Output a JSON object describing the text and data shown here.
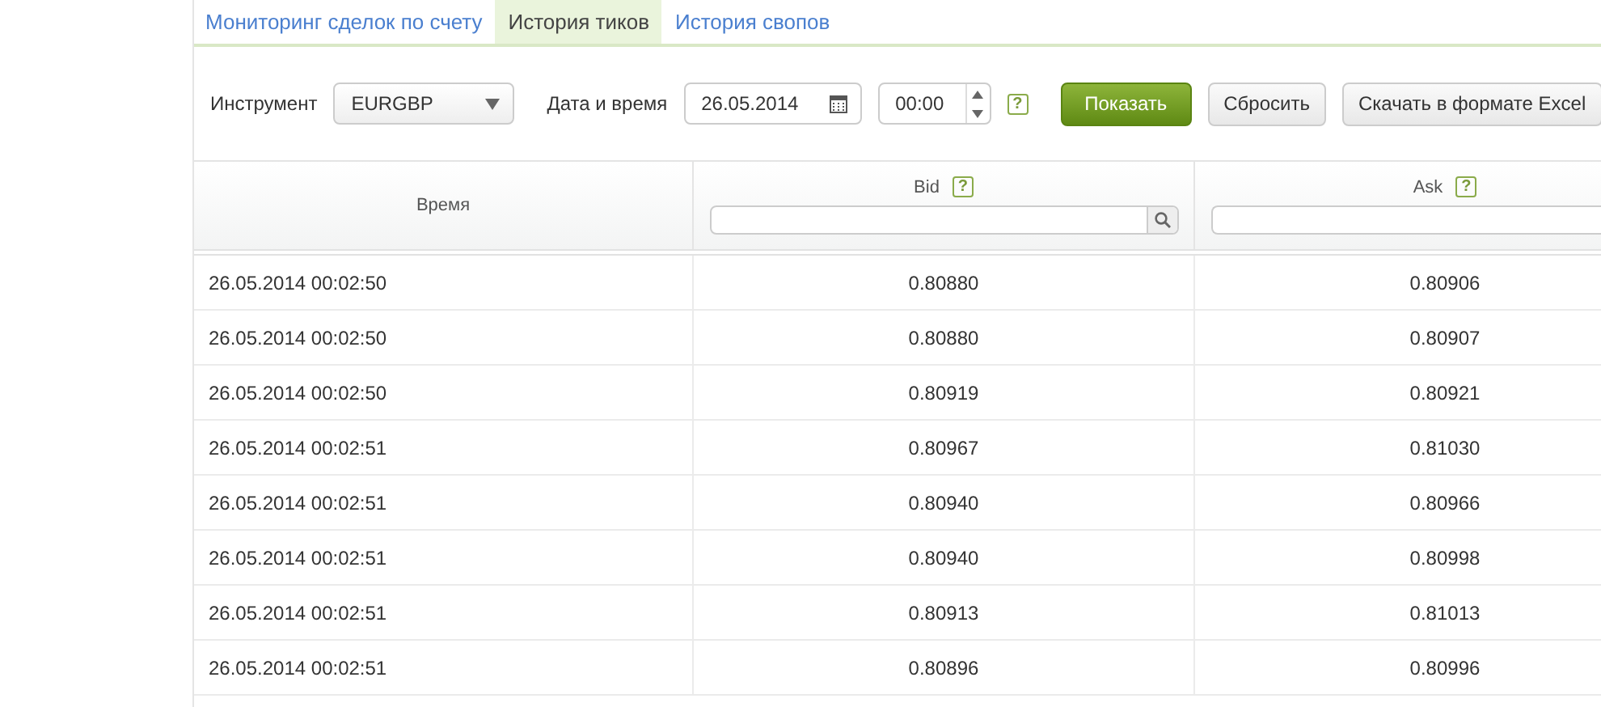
{
  "tabs": [
    {
      "label": "Мониторинг сделок по счету",
      "selected": false
    },
    {
      "label": "История тиков",
      "selected": true
    },
    {
      "label": "История свопов",
      "selected": false
    }
  ],
  "filters": {
    "instrument_label": "Инструмент",
    "instrument": "EURGBP",
    "datetime_label": "Дата и время",
    "date": "26.05.2014",
    "time": "00:00",
    "help": "?"
  },
  "buttons": [
    {
      "label": "Показать",
      "kind": "primary"
    },
    {
      "label": "Сбросить",
      "kind": "plain"
    },
    {
      "label": "Скачать в формате Excel",
      "kind": "plain"
    }
  ],
  "table": {
    "columns": [
      {
        "label": "Время",
        "filter": false
      },
      {
        "label": "Bid",
        "help": "?",
        "filter": true,
        "search_button": true
      },
      {
        "label": "Ask",
        "help": "?",
        "filter": true
      }
    ],
    "rows": [
      [
        "26.05.2014 00:02:50",
        "0.80880",
        "0.80906"
      ],
      [
        "26.05.2014 00:02:50",
        "0.80880",
        "0.80907"
      ],
      [
        "26.05.2014 00:02:50",
        "0.80919",
        "0.80921"
      ],
      [
        "26.05.2014 00:02:51",
        "0.80967",
        "0.81030"
      ],
      [
        "26.05.2014 00:02:51",
        "0.80940",
        "0.80966"
      ],
      [
        "26.05.2014 00:02:51",
        "0.80940",
        "0.80998"
      ],
      [
        "26.05.2014 00:02:51",
        "0.80913",
        "0.81013"
      ],
      [
        "26.05.2014 00:02:51",
        "0.80896",
        "0.80996"
      ]
    ]
  }
}
